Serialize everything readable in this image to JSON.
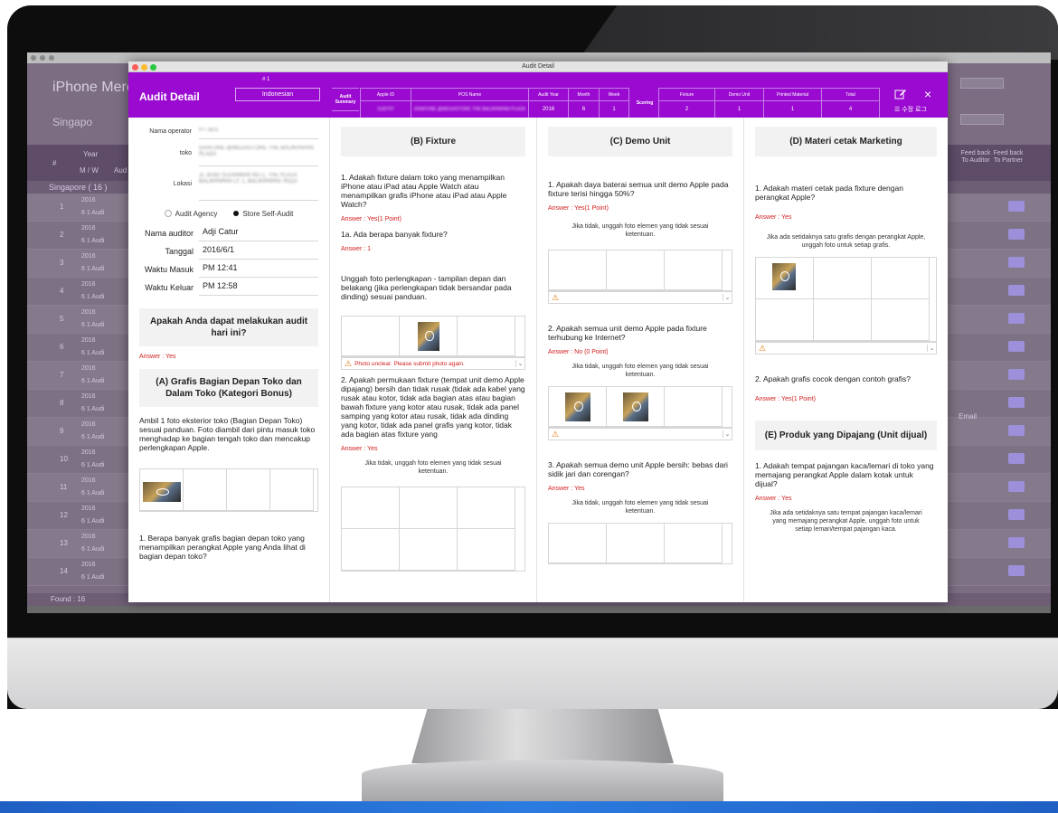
{
  "background_app": {
    "brand": "iPhone Merch",
    "country_filter": "Singapo",
    "header_cols": [
      "#",
      "Year",
      "M / W",
      "Aud"
    ],
    "group_label": "Singapore ( 16 )",
    "rows": [
      {
        "num": "1",
        "year": "2016",
        "sub": "6 1 Audi"
      },
      {
        "num": "2",
        "year": "2016",
        "sub": "6 1 Audi"
      },
      {
        "num": "3",
        "year": "2016",
        "sub": "6 1 Audi"
      },
      {
        "num": "4",
        "year": "2016",
        "sub": "6 1 Audi"
      },
      {
        "num": "5",
        "year": "2016",
        "sub": "6 1 Audi"
      },
      {
        "num": "6",
        "year": "2016",
        "sub": "6 1 Audi"
      },
      {
        "num": "7",
        "year": "2016",
        "sub": "6 1 Audi"
      },
      {
        "num": "8",
        "year": "2016",
        "sub": "6 1 Audi"
      },
      {
        "num": "9",
        "year": "2016",
        "sub": "6 1 Audi"
      },
      {
        "num": "10",
        "year": "2016",
        "sub": "6 1 Audi"
      },
      {
        "num": "11",
        "year": "2016",
        "sub": "6 1 Audi"
      },
      {
        "num": "12",
        "year": "2016",
        "sub": "6 1 Audi"
      },
      {
        "num": "13",
        "year": "2016",
        "sub": "6 1 Audi"
      },
      {
        "num": "14",
        "year": "2016",
        "sub": "6 1 Audi"
      }
    ],
    "right_headers": [
      "Feed back To Auditor",
      "Feed back To Partner"
    ],
    "email_label": "Email",
    "found": "Found : 16"
  },
  "window": {
    "title": "Audit Detail"
  },
  "header": {
    "title": "Audit Detail",
    "number": "# 1",
    "language": "Indonesian",
    "summary_label": "Audit Summary",
    "summary": {
      "apple_id_label": "Apple ID",
      "pos_name_label": "POS Name",
      "audit_year_label": "Audit Year",
      "month_label": "Month",
      "week_label": "Week",
      "apple_id_value": "1190707",
      "pos_name_value": "ERAFONE @MEGASTORE THE BALIKPAPAN PLAZA",
      "audit_year_value": "2016",
      "month_value": "6",
      "week_value": "1"
    },
    "scoring_label": "Scoring",
    "scoring": {
      "fixture_label": "Fixture",
      "demo_unit_label": "Demo Unit",
      "printed_label": "Printed Material",
      "total_label": "Total",
      "fixture_value": "2",
      "demo_unit_value": "1",
      "printed_value": "1",
      "total_value": "4"
    },
    "edit_label": "수정 로그"
  },
  "col1": {
    "operator_label": "Nama operator",
    "operator_value": "PT SES",
    "toko_label": "toko",
    "toko_value": "ERAFONE @MEGASTORE THE BALIKPAPAN PLAZA",
    "lokasi_label": "Lokasi",
    "lokasi_value": "JL JEND SUDIRMAN NO.1, THE PLAZA BALIKPAPAN LT. 1, BALIKPAPAN 76113",
    "radio_agency": "Audit Agency",
    "radio_self": "Store Self-Audit",
    "auditor_label": "Nama auditor",
    "auditor_value": "Adji Catur",
    "tanggal_label": "Tanggal",
    "tanggal_value": "2016/6/1",
    "masuk_label": "Waktu Masuk",
    "masuk_value": "PM 12:41",
    "keluar_label": "Waktu Keluar",
    "keluar_value": "PM 12:58",
    "q_audit": "Apakah Anda dapat melakukan audit hari ini?",
    "q_audit_answer": "Answer : Yes",
    "section_a": "(A) Grafis Bagian Depan Toko dan Dalam Toko (Kategori Bonus)",
    "section_a_text": "Ambil 1 foto eksterior toko (Bagian Depan Toko) sesuai panduan. Foto diambil dari pintu masuk toko menghadap ke bagian tengah toko dan mencakup perlengkapan Apple.",
    "section_a_q1": "1. Berapa banyak grafis bagian depan toko yang menampilkan perangkat Apple yang Anda lihat di bagian depan toko?"
  },
  "col2": {
    "section": "(B) Fixture",
    "q1": "1. Adakah fixture dalam toko yang menampilkan iPhone atau iPad atau Apple Watch atau menampilkan grafis iPhone atau iPad atau Apple Watch?",
    "q1_answer": "Answer : Yes(1 Point)",
    "q1a": "1a. Ada berapa banyak fixture?",
    "q1a_answer": "Answer : 1",
    "photo_instr": "Unggah foto perlengkapan - tampilan depan dan belakang (jika perlengkapan tidak bersandar pada dinding) sesuai panduan.",
    "warning": "Photo unclear. Please submit photo again.",
    "q2": "2. Apakah permukaan fixture (tempat unit demo Apple dipajang) bersih dan tidak rusak (tidak ada kabel yang rusak atau kotor, tidak ada bagian atas atau bagian bawah fixture yang kotor atau rusak, tidak ada panel samping yang kotor atau rusak, tidak ada dinding yang kotor, tidak ada panel grafis yang kotor, tidak ada bagian atas fixture yang",
    "q2_answer": "Answer : Yes",
    "hint": "Jika tidak, unggah foto elemen yang tidak sesuai ketentuan."
  },
  "col3": {
    "section": "(C) Demo Unit",
    "q1": "1. Apakah daya baterai semua unit demo Apple pada fixture terisi hingga 50%?",
    "q1_answer": "Answer : Yes(1 Point)",
    "hint1": "Jika tidak, unggah foto elemen yang tidak sesuai ketentuan.",
    "q2": "2. Apakah semua unit demo Apple pada fixture terhubung ke Internet?",
    "q2_answer": "Answer : No (0 Point)",
    "hint2": "Jika tidak, unggah foto elemen yang tidak sesuai ketentuan.",
    "q3": "3. Apakah semua demo unit Apple bersih: bebas dari sidik jari dan corengan?",
    "q3_answer": "Answer : Yes",
    "hint3": "Jika tidak, unggah foto elemen yang tidak sesuai ketentuan."
  },
  "col4": {
    "section_d": "(D) Materi cetak Marketing",
    "q1": "1. Adakah materi cetak pada fixture dengan perangkat Apple?",
    "q1_answer": "Answer : Yes",
    "hint1": "Jika ada setidaknya satu grafis dengan perangkat Apple, unggah foto untuk setiap grafis.",
    "q2": "2. Apakah grafis cocok dengan contoh grafis?",
    "q2_answer": "Answer : Yes(1 Point)",
    "section_e": "(E) Produk yang Dipajang (Unit dijual)",
    "e_q1": "1. Adakah tempat pajangan kaca/lemari di toko yang memajang perangkat Apple dalam kotak untuk dijual?",
    "e_q1_answer": "Answer : Yes",
    "e_hint": "Jika ada setidaknya satu tempat pajangan kaca/lemari yang memajang perangkat Apple, unggah foto untuk setiap lemari/tempat pajangan kaca."
  }
}
